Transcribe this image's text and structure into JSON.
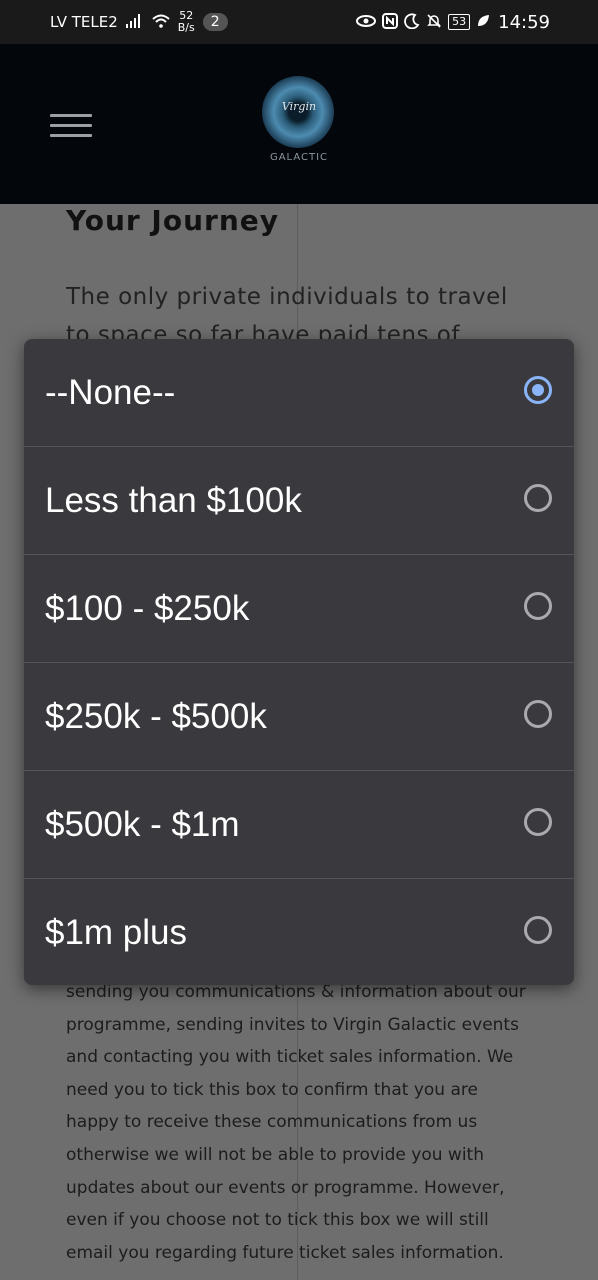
{
  "status_bar": {
    "carrier": "LV TELE2",
    "net_speed_value": "52",
    "net_speed_unit": "B/s",
    "notification_count": "2",
    "battery": "53",
    "time": "14:59"
  },
  "header": {
    "logo_brand": "Virgin",
    "logo_text": "GALACTIC"
  },
  "page": {
    "heading": "Your Journey",
    "intro": "The only private individuals to travel to space so far have paid tens of millions",
    "body_text": "sending you communications & information about our programme, sending invites to Virgin Galactic events and contacting you with ticket sales information. We need you to tick this box to confirm that you are happy to receive these communications from us otherwise we will not be able to provide you with updates about our events or programme. However, even if you choose not to tick this box we will still email you regarding future ticket sales information."
  },
  "dialog": {
    "options": [
      {
        "label": "--None--",
        "selected": true
      },
      {
        "label": "Less than $100k",
        "selected": false
      },
      {
        "label": "$100 - $250k",
        "selected": false
      },
      {
        "label": "$250k - $500k",
        "selected": false
      },
      {
        "label": "$500k - $1m",
        "selected": false
      },
      {
        "label": "$1m plus",
        "selected": false
      }
    ]
  },
  "colors": {
    "accent": "#8ab4f8",
    "dialog_bg": "#3a3a3e",
    "header_bg": "#03060b"
  },
  "icons": [
    "signal-icon",
    "wifi-icon",
    "eye-comfort-icon",
    "nfc-icon",
    "moon-icon",
    "mute-icon",
    "leaf-icon",
    "menu-icon"
  ]
}
